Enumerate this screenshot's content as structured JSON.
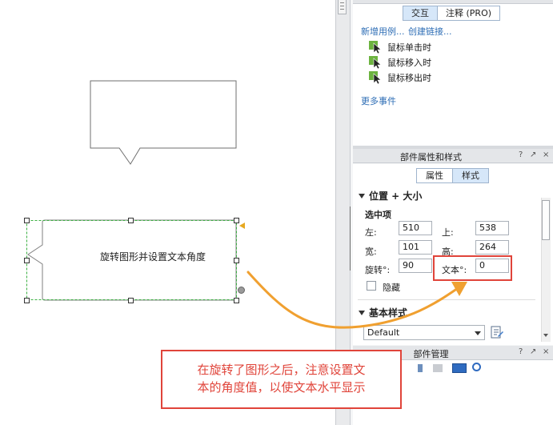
{
  "canvas": {
    "selected_shape_label": "旋转图形并设置文本角度"
  },
  "interaction_panel": {
    "tabs": [
      "交互",
      "注释 (PRO)"
    ],
    "active_tab": "交互",
    "link_new_case": "新增用例...",
    "link_create_link": "创建链接...",
    "events": [
      "鼠标单击时",
      "鼠标移入时",
      "鼠标移出时"
    ],
    "more_events": "更多事件"
  },
  "props_panel": {
    "title": "部件属性和样式",
    "help": "?",
    "pin": "↗",
    "close": "×",
    "tabs": [
      "属性",
      "样式"
    ],
    "active_tab": "样式",
    "section_position_size": "位置 + 大小",
    "selected_item": "选中项",
    "left_label": "左:",
    "left_value": "510",
    "top_label": "上:",
    "top_value": "538",
    "width_label": "宽:",
    "width_value": "101",
    "height_label": "高:",
    "height_value": "264",
    "rotation_label": "旋转°:",
    "rotation_value": "90",
    "text_label": "文本°:",
    "text_value": "0",
    "hidden_label": "隐藏",
    "section_basic_style": "基本样式",
    "style_select_value": "Default"
  },
  "widget_manager": {
    "title": "部件管理",
    "help": "?",
    "pin": "↗",
    "close": "×"
  },
  "annotation": {
    "line1": "在旋转了图形之后，注意设置文",
    "line2": "本的角度值，以使文本水平显示",
    "color": "#e0443a",
    "arrow_color": "#f0a030"
  }
}
